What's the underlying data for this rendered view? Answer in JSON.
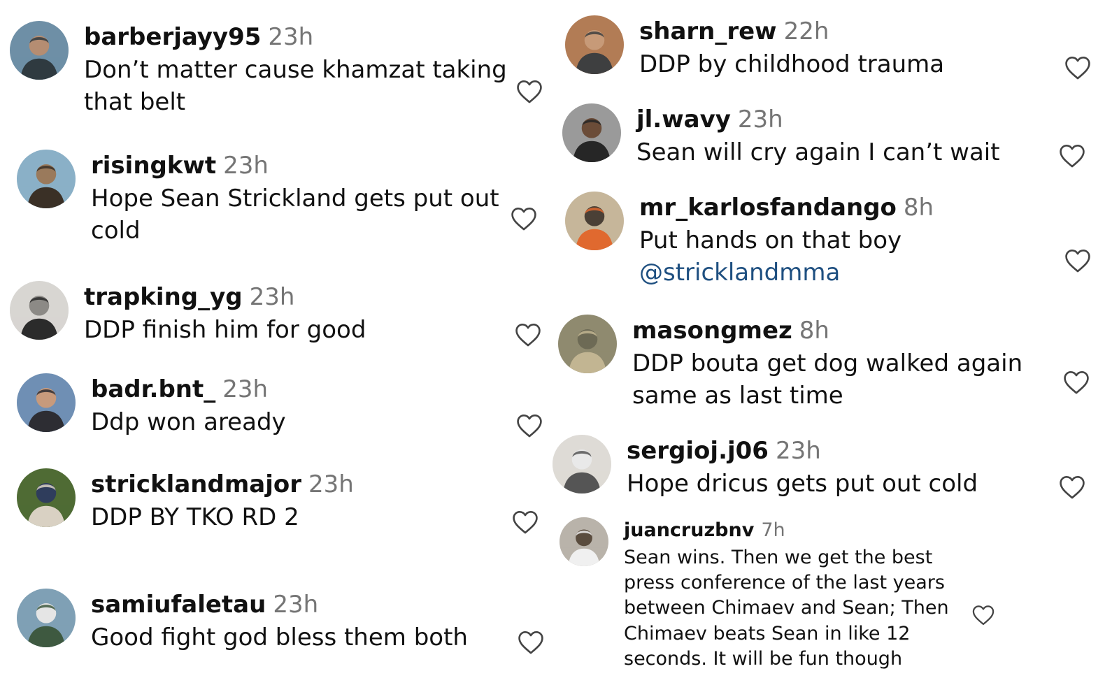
{
  "comments": [
    {
      "user": "barberjayy95",
      "time": "23h",
      "text": [
        "Don’t matter cause khamzat taking",
        "that belt"
      ],
      "avatar": "man-face-avatar",
      "colors": [
        "#6e8fa6",
        "#2f3a40",
        "#b58d72"
      ]
    },
    {
      "user": "risingkwt",
      "time": "23h",
      "text": [
        "Hope Sean Strickland gets put out",
        "cold"
      ],
      "avatar": "man-in-hat-avatar",
      "colors": [
        "#8ab0c7",
        "#3a3026",
        "#9a7a5c"
      ]
    },
    {
      "user": "trapking_yg",
      "time": "23h",
      "text": [
        "DDP finish him for good"
      ],
      "avatar": "figure-in-room-avatar",
      "colors": [
        "#d8d6d2",
        "#2b2b2b",
        "#8c8a86"
      ]
    },
    {
      "user": "badr.bnt_",
      "time": "23h",
      "text": [
        "Ddp won aready"
      ],
      "avatar": "man-city-avatar",
      "colors": [
        "#6f8fb4",
        "#2d2d33",
        "#c79a7c"
      ]
    },
    {
      "user": "stricklandmajor",
      "time": "23h",
      "text": [
        "DDP BY TKO RD 2"
      ],
      "avatar": "couple-outdoor-avatar",
      "colors": [
        "#4f6b34",
        "#d9d1c3",
        "#2f3d5c"
      ]
    },
    {
      "user": "samiufaletau",
      "time": "23h",
      "text": [
        "Good fight god bless them both"
      ],
      "avatar": "man-standing-avatar",
      "colors": [
        "#7fa0b5",
        "#3e5940",
        "#e5e5e5"
      ]
    },
    {
      "user": "sharn_rew",
      "time": "22h",
      "text": [
        "DDP by childhood trauma"
      ],
      "avatar": "man-arms-crossed-avatar",
      "colors": [
        "#b27c55",
        "#3e3f40",
        "#c79a78"
      ]
    },
    {
      "user": "jl.wavy",
      "time": "23h",
      "text": [
        "Sean will cry again I can’t wait"
      ],
      "avatar": "bearded-man-avatar",
      "colors": [
        "#9a9a9a",
        "#262626",
        "#6b4c38"
      ]
    },
    {
      "user": "mr_karlosfandango",
      "time": "8h",
      "text": [
        "Put hands on that boy"
      ],
      "mention": "@stricklandmma",
      "avatar": "couple-avatar",
      "colors": [
        "#c6b69a",
        "#e0692f",
        "#4a4036"
      ]
    },
    {
      "user": "masongmez",
      "time": "8h",
      "text": [
        "DDP bouta get dog walked again",
        "same as last time"
      ],
      "avatar": "soldiers-hugging-avatar",
      "colors": [
        "#8f8a6f",
        "#c2b592",
        "#6d6a55"
      ]
    },
    {
      "user": "sergioj.j06",
      "time": "23h",
      "text": [
        "Hope dricus gets put out cold"
      ],
      "avatar": "man-in-hallway-avatar",
      "colors": [
        "#dedbd6",
        "#555555",
        "#e9e9e9"
      ]
    },
    {
      "user": "juancruzbnv",
      "time": "7h",
      "text": [
        "Sean wins. Then we get the best",
        "press conference of the last years",
        "between Chimaev and Sean; Then",
        "Chimaev beats Sean in like 12",
        "seconds. It will be fun though"
      ],
      "avatar": "man-white-shirt-avatar",
      "colors": [
        "#b9b3aa",
        "#f0f0f0",
        "#5a4c3e"
      ]
    }
  ],
  "heart_icon": "heart-outline-icon",
  "colors": {
    "username": "#111111",
    "timestamp": "#757575",
    "mention": "#1e4f80",
    "heart": "#444444"
  }
}
